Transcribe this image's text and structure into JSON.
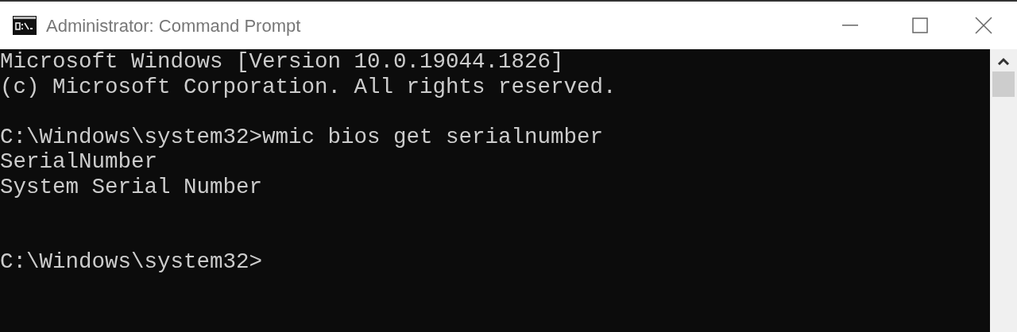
{
  "window": {
    "title": "Administrator: Command Prompt"
  },
  "console": {
    "lines": [
      {
        "kind": "text",
        "text": "Microsoft Windows [Version 10.0.19044.1826]"
      },
      {
        "kind": "text",
        "text": "(c) Microsoft Corporation. All rights reserved."
      },
      {
        "kind": "blank"
      },
      {
        "kind": "text",
        "text": "C:\\Windows\\system32>wmic bios get serialnumber"
      },
      {
        "kind": "text",
        "text": "SerialNumber"
      },
      {
        "kind": "text",
        "text": "System Serial Number"
      },
      {
        "kind": "blank"
      },
      {
        "kind": "blank"
      },
      {
        "kind": "text",
        "text": "C:\\Windows\\system32>"
      }
    ]
  }
}
